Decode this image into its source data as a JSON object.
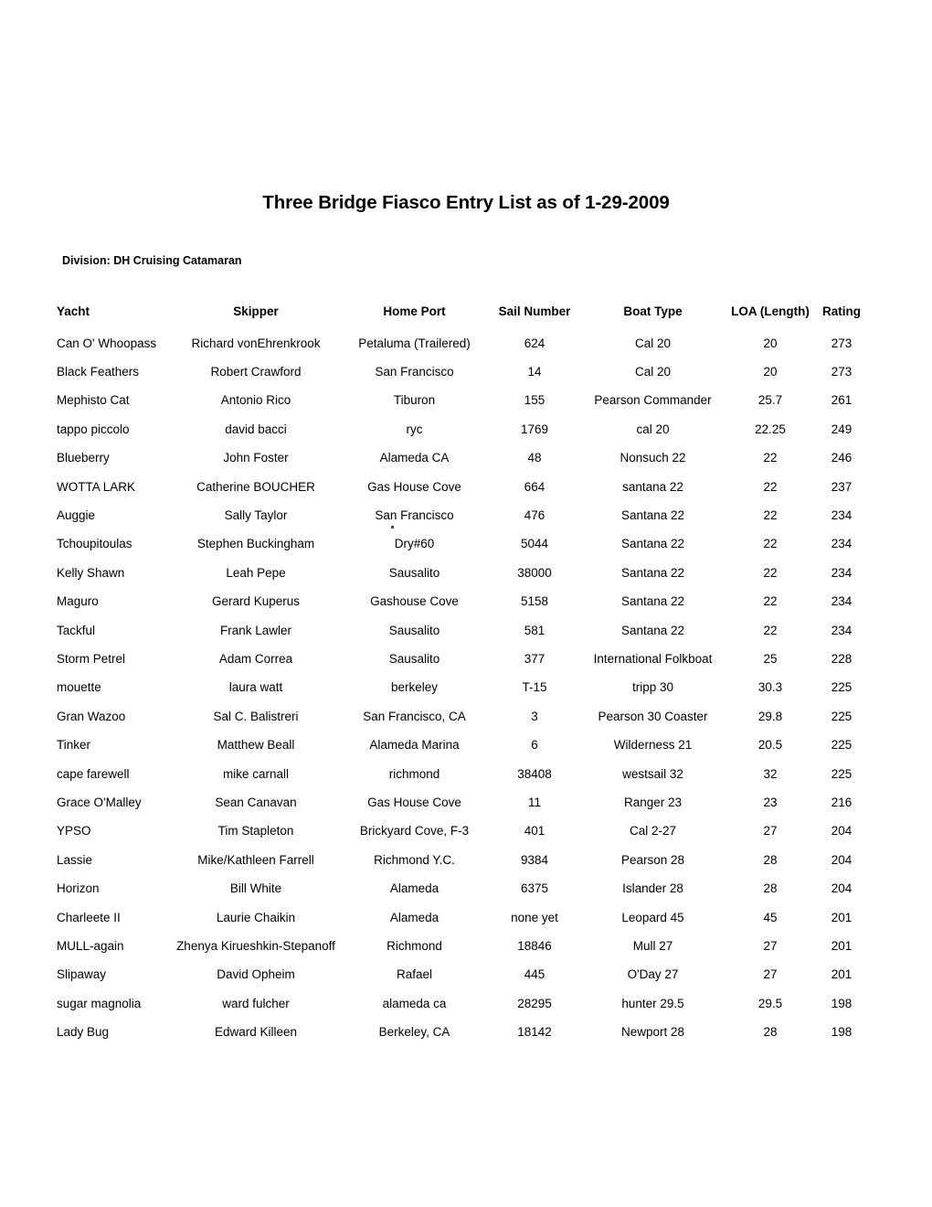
{
  "document": {
    "title": "Three Bridge Fiasco Entry List as of 1-29-2009",
    "division_label": "Division: DH Cruising Catamaran"
  },
  "table": {
    "headers": {
      "yacht": "Yacht",
      "skipper": "Skipper",
      "home_port": "Home Port",
      "sail_number": "Sail Number",
      "boat_type": "Boat Type",
      "loa": "LOA (Length)",
      "rating": "Rating"
    },
    "rows": [
      {
        "yacht": "Can O' Whoopass",
        "skipper": "Richard vonEhrenkrook",
        "home_port": "Petaluma (Trailered)",
        "sail_number": "624",
        "boat_type": "Cal 20",
        "loa": "20",
        "rating": "273"
      },
      {
        "yacht": "Black Feathers",
        "skipper": "Robert Crawford",
        "home_port": "San Francisco",
        "sail_number": "14",
        "boat_type": "Cal 20",
        "loa": "20",
        "rating": "273"
      },
      {
        "yacht": "Mephisto Cat",
        "skipper": "Antonio Rico",
        "home_port": "Tiburon",
        "sail_number": "155",
        "boat_type": "Pearson Commander",
        "loa": "25.7",
        "rating": "261"
      },
      {
        "yacht": "tappo piccolo",
        "skipper": "david bacci",
        "home_port": "ryc",
        "sail_number": "1769",
        "boat_type": "cal 20",
        "loa": "22.25",
        "rating": "249"
      },
      {
        "yacht": "Blueberry",
        "skipper": "John Foster",
        "home_port": "Alameda CA",
        "sail_number": "48",
        "boat_type": "Nonsuch 22",
        "loa": "22",
        "rating": "246"
      },
      {
        "yacht": "WOTTA LARK",
        "skipper": "Catherine BOUCHER",
        "home_port": "Gas House Cove",
        "sail_number": "664",
        "boat_type": "santana 22",
        "loa": "22",
        "rating": "237"
      },
      {
        "yacht": "Auggie",
        "skipper": "Sally Taylor",
        "home_port": "San Francisco",
        "sail_number": "476",
        "boat_type": "Santana 22",
        "loa": "22",
        "rating": "234"
      },
      {
        "yacht": "Tchoupitoulas",
        "skipper": "Stephen Buckingham",
        "home_port": "Dry#60",
        "sail_number": "5044",
        "boat_type": "Santana 22",
        "loa": "22",
        "rating": "234"
      },
      {
        "yacht": "Kelly Shawn",
        "skipper": "Leah Pepe",
        "home_port": "Sausalito",
        "sail_number": "38000",
        "boat_type": "Santana 22",
        "loa": "22",
        "rating": "234"
      },
      {
        "yacht": "Maguro",
        "skipper": "Gerard Kuperus",
        "home_port": "Gashouse Cove",
        "sail_number": "5158",
        "boat_type": "Santana 22",
        "loa": "22",
        "rating": "234"
      },
      {
        "yacht": "Tackful",
        "skipper": "Frank Lawler",
        "home_port": "Sausalito",
        "sail_number": "581",
        "boat_type": "Santana 22",
        "loa": "22",
        "rating": "234"
      },
      {
        "yacht": "Storm Petrel",
        "skipper": "Adam Correa",
        "home_port": "Sausalito",
        "sail_number": "377",
        "boat_type": "International Folkboat",
        "loa": "25",
        "rating": "228"
      },
      {
        "yacht": "mouette",
        "skipper": "laura watt",
        "home_port": "berkeley",
        "sail_number": "T-15",
        "boat_type": "tripp 30",
        "loa": "30.3",
        "rating": "225"
      },
      {
        "yacht": "Gran Wazoo",
        "skipper": "Sal C. Balistreri",
        "home_port": "San Francisco, CA",
        "sail_number": "3",
        "boat_type": "Pearson 30 Coaster",
        "loa": "29.8",
        "rating": "225"
      },
      {
        "yacht": "Tinker",
        "skipper": "Matthew Beall",
        "home_port": "Alameda Marina",
        "sail_number": "6",
        "boat_type": "Wilderness 21",
        "loa": "20.5",
        "rating": "225"
      },
      {
        "yacht": "cape farewell",
        "skipper": "mike carnall",
        "home_port": "richmond",
        "sail_number": "38408",
        "boat_type": "westsail 32",
        "loa": "32",
        "rating": "225"
      },
      {
        "yacht": "Grace O'Malley",
        "skipper": "Sean Canavan",
        "home_port": "Gas House Cove",
        "sail_number": "11",
        "boat_type": "Ranger 23",
        "loa": "23",
        "rating": "216"
      },
      {
        "yacht": "YPSO",
        "skipper": "Tim Stapleton",
        "home_port": "Brickyard Cove, F-3",
        "sail_number": "401",
        "boat_type": "Cal 2-27",
        "loa": "27",
        "rating": "204"
      },
      {
        "yacht": "Lassie",
        "skipper": "Mike/Kathleen Farrell",
        "home_port": "Richmond Y.C.",
        "sail_number": "9384",
        "boat_type": "Pearson 28",
        "loa": "28",
        "rating": "204"
      },
      {
        "yacht": "Horizon",
        "skipper": "Bill White",
        "home_port": "Alameda",
        "sail_number": "6375",
        "boat_type": "Islander 28",
        "loa": "28",
        "rating": "204"
      },
      {
        "yacht": "Charleete II",
        "skipper": "Laurie Chaikin",
        "home_port": "Alameda",
        "sail_number": "none yet",
        "boat_type": "Leopard 45",
        "loa": "45",
        "rating": "201"
      },
      {
        "yacht": "MULL-again",
        "skipper": "Zhenya Kirueshkin-Stepanoff",
        "home_port": "Richmond",
        "sail_number": "18846",
        "boat_type": "Mull 27",
        "loa": "27",
        "rating": "201"
      },
      {
        "yacht": "Slipaway",
        "skipper": "David Opheim",
        "home_port": "Rafael",
        "sail_number": "445",
        "boat_type": "O'Day 27",
        "loa": "27",
        "rating": "201"
      },
      {
        "yacht": "sugar magnolia",
        "skipper": "ward fulcher",
        "home_port": "alameda ca",
        "sail_number": "28295",
        "boat_type": "hunter 29.5",
        "loa": "29.5",
        "rating": "198"
      },
      {
        "yacht": "Lady Bug",
        "skipper": "Edward Killeen",
        "home_port": "Berkeley, CA",
        "sail_number": "18142",
        "boat_type": "Newport 28",
        "loa": "28",
        "rating": "198"
      }
    ]
  }
}
